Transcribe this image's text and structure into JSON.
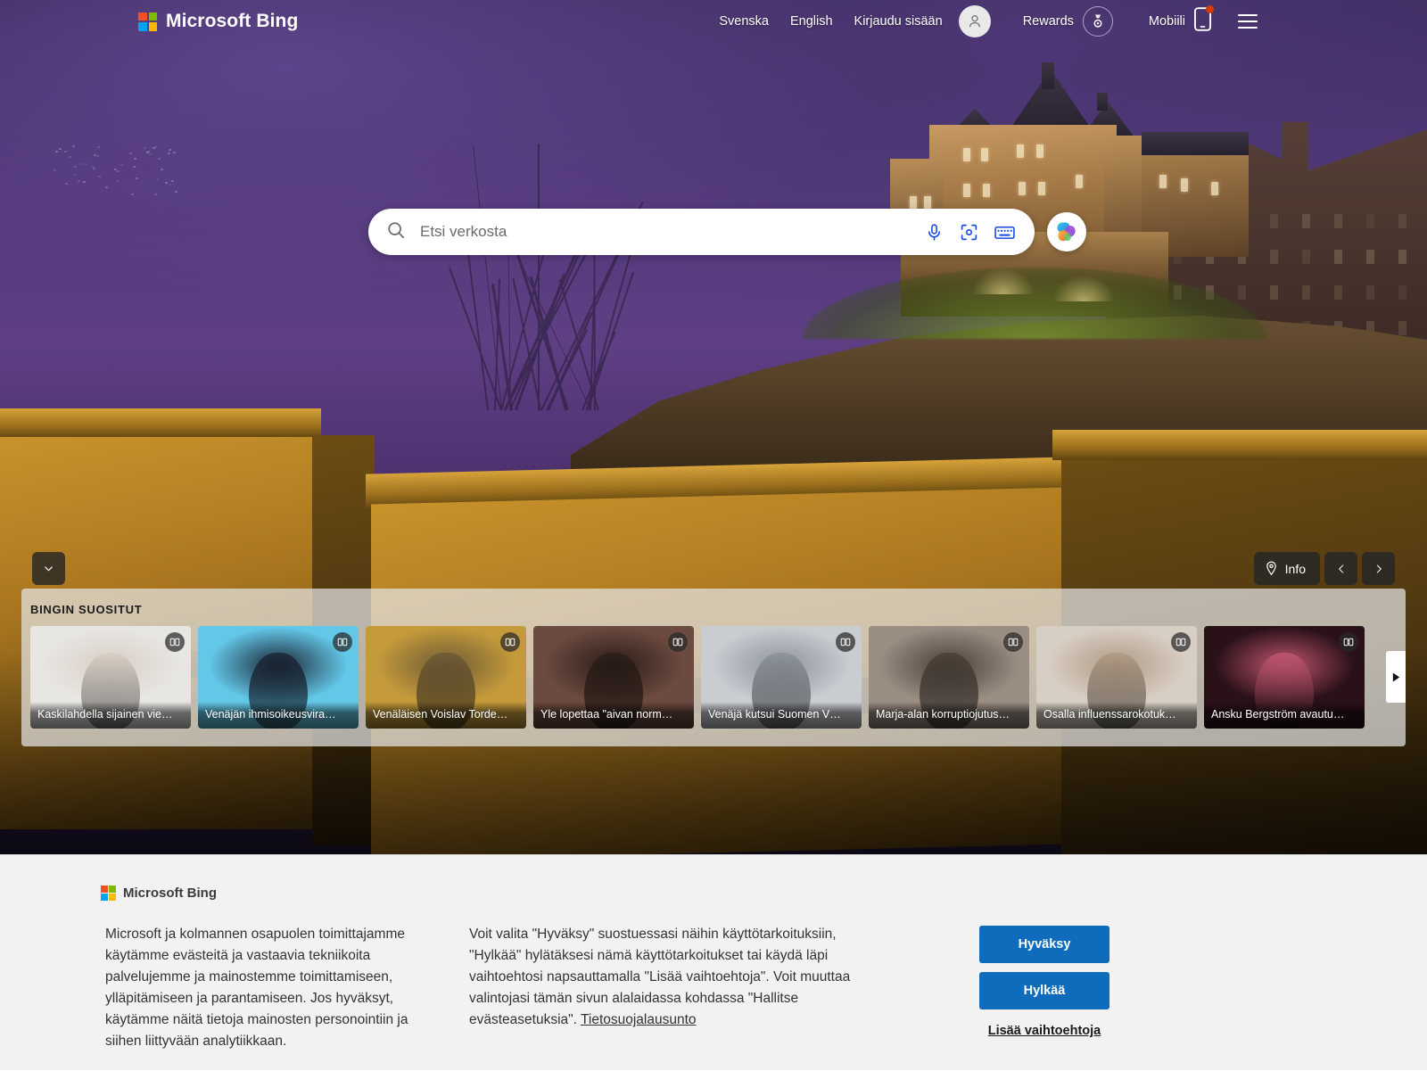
{
  "header": {
    "brand": "Microsoft Bing",
    "logo_icon": "microsoft-logo",
    "links": [
      {
        "label": "Svenska",
        "name": "lang-svenska"
      },
      {
        "label": "English",
        "name": "lang-english"
      },
      {
        "label": "Kirjaudu sisään",
        "name": "sign-in"
      }
    ],
    "avatar_icon": "person-icon",
    "rewards_label": "Rewards",
    "rewards_icon": "medal-icon",
    "mobile_label": "Mobiili",
    "mobile_icon": "phone-icon",
    "menu_icon": "hamburger-icon"
  },
  "search": {
    "placeholder": "Etsi verkosta",
    "value": "",
    "search_icon": "search-icon",
    "mic_icon": "microphone-icon",
    "lens_icon": "camera-lens-icon",
    "keyboard_icon": "keyboard-icon",
    "copilot_icon": "copilot-icon",
    "accent": "#174ae3"
  },
  "hero": {
    "collapse_icon": "chevron-down-icon",
    "info_label": "Info",
    "info_icon": "location-pin-icon",
    "prev_icon": "chevron-left-icon",
    "next_icon": "chevron-right-icon",
    "sky_color": "#5e3f84",
    "stone_color": "#c8922b"
  },
  "news": {
    "title": "BINGIN SUOSITUT",
    "next_icon": "play-arrow-icon",
    "badge_icon": "article-pages-icon",
    "cards": [
      {
        "title": "Kaskilahdella sijainen vie…",
        "thumb": "#e8e6e3",
        "accent": "#d9cfc6"
      },
      {
        "title": "Venäjän ihmisoikeusvira…",
        "thumb": "#63c8e8",
        "accent": "#1b2535"
      },
      {
        "title": "Venäläisen Voislav Torde…",
        "thumb": "#c49a3a",
        "accent": "#6e5a35"
      },
      {
        "title": "Yle lopettaa \"aivan norm…",
        "thumb": "#6b4a3f",
        "accent": "#2b1d18"
      },
      {
        "title": "Venäjä kutsui Suomen V…",
        "thumb": "#c9ccd1",
        "accent": "#8d939b"
      },
      {
        "title": "Marja-alan korruptiojutus…",
        "thumb": "#9a8d82",
        "accent": "#4a4038"
      },
      {
        "title": "Osalla influenssarokotuk…",
        "thumb": "#d8cfc4",
        "accent": "#b09a84"
      },
      {
        "title": "Ansku Bergström avautu…",
        "thumb": "#2a1118",
        "accent": "#c0566f"
      }
    ]
  },
  "cookie": {
    "brand": "Microsoft Bing",
    "paragraph_left": "Microsoft ja kolmannen osapuolen toimittajamme käytämme evästeitä ja vastaavia tekniikoita palvelujemme ja mainostemme toimittamiseen, ylläpitämiseen ja parantamiseen. Jos hyväksyt, käytämme näitä tietoja mainosten personointiin ja siihen liittyvään analytiikkaan.",
    "paragraph_right": "Voit valita \"Hyväksy\" suostuessasi näihin käyttötarkoituksiin, \"Hylkää\" hylätäksesi nämä käyttötarkoitukset tai käydä läpi vaihtoehtosi napsauttamalla \"Lisää vaihtoehtoja\". Voit muuttaa valintojasi tämän sivun alalaidassa kohdassa \"Hallitse evästeasetuksia\". ",
    "privacy_link": "Tietosuojalausunto",
    "accept_label": "Hyväksy",
    "reject_label": "Hylkää",
    "more_label": "Lisää vaihtoehtoja",
    "button_color": "#0f6cbd"
  }
}
